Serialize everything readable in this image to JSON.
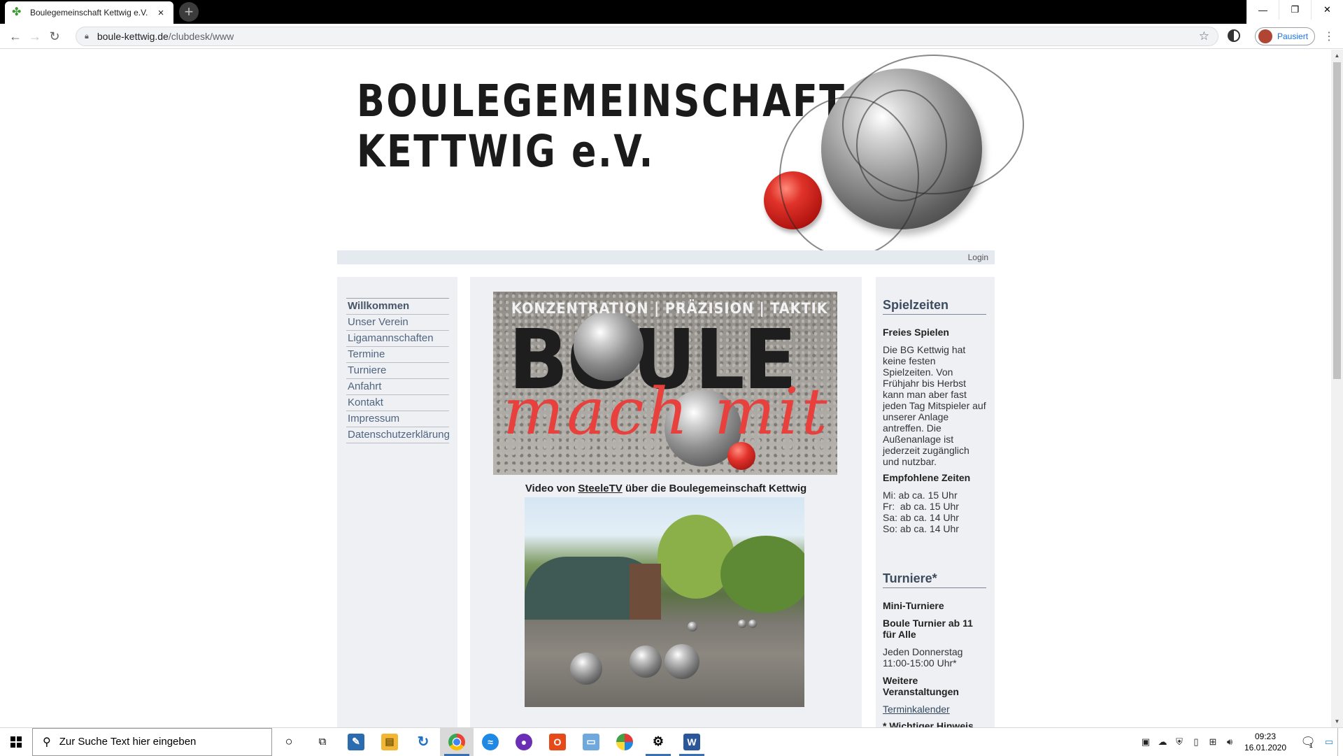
{
  "browser": {
    "tab_title": "Boulegemeinschaft Kettwig e.V.",
    "tab_close": "×",
    "newtab_label": "+",
    "url_host": "boule-kettwig.de",
    "url_path": "/clubdesk/www",
    "profile_label": "Pausiert",
    "window_buttons": {
      "minimize": "—",
      "restore": "❐",
      "close": "✕"
    }
  },
  "site": {
    "header_line1": "BOULEGEMEINSCHAFT",
    "header_line2": "KETTWIG e.V.",
    "login_label": "Login",
    "nav": [
      "Willkommen",
      "Unser Verein",
      "Ligamannschaften",
      "Termine",
      "Turniere",
      "Anfahrt",
      "Kontakt",
      "Impressum",
      "Datenschutzerklärung"
    ],
    "banner": {
      "tagline": "KONZENTRATION | PRÄZISION | TAKTIK",
      "word": "BOULE",
      "script": "mach mit"
    },
    "video_caption_pre": "Video von ",
    "video_caption_link": "SteeleTV",
    "video_caption_post": " über die Boulegemeinschaft Kettwig",
    "sidebar": {
      "spielzeiten_title": "Spielzeiten",
      "freies_spielen_title": "Freies Spielen",
      "freies_spielen_text": "Die BG Kettwig hat keine festen Spielzeiten. Von Frühjahr bis Herbst kann man aber fast jeden Tag Mitspieler auf unserer Anlage antreffen. Die Außenanlage ist jederzeit zugänglich und nutzbar.",
      "empfohlene_title": "Empfohlene Zeiten",
      "times": [
        "Mi: ab ca. 15 Uhr",
        "Fr:  ab ca. 15 Uhr",
        "Sa: ab ca. 14 Uhr",
        "So: ab ca. 14 Uhr"
      ],
      "turniere_title": "Turniere*",
      "mini_turniere": "Mini-Turniere",
      "boule_turnier": "Boule Turnier ab 11 für Alle",
      "turnier_time": "Jeden Donnerstag 11:00-15:00 Uhr*",
      "weitere": "Weitere Veranstaltungen",
      "terminkalender": "Terminkalender",
      "hinweis": "* Wichtiger Hinweis"
    }
  },
  "taskbar": {
    "search_placeholder": "Zur Suche Text hier eingeben",
    "clock_time": "09:23",
    "clock_date": "16.01.2020",
    "notification_count": "1"
  },
  "colors": {
    "accent": "#3c4b60",
    "nav_text": "#4f6580",
    "column_bg": "#eef0f3",
    "banner_red": "#e8413d"
  }
}
